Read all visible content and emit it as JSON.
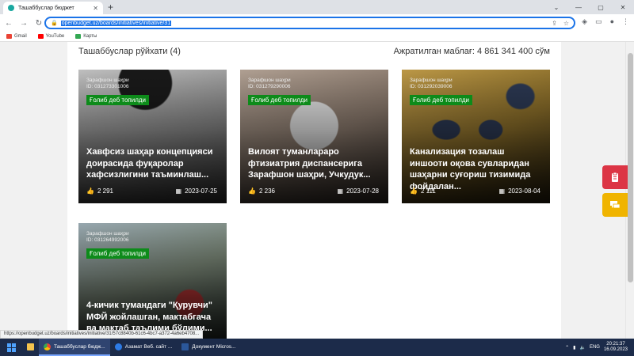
{
  "browser": {
    "tab_title": "Ташаббуслар бюджет",
    "url": "openbudget.uz/boards/initiatives/initiative/31",
    "bookmarks": [
      "Gmail",
      "YouTube",
      "Карты"
    ],
    "status_url": "https://openbudget.uz/boards/initiatives/initiative/31/57c8840b-61c6-4bc7-a372-4a6eb4708..."
  },
  "header": {
    "list_title": "Ташаббуслар рўйхати (4)",
    "allocated": "Ажратилган маблағ: 4 861 341 400 сўм"
  },
  "cards": [
    {
      "location": "Зарафшон шаҳри",
      "id": "ID: 031273301006",
      "badge": "Ғолиб деб топилди",
      "title": "Хавфсиз шаҳар концепцияси доирасида фуқаролар хафсизлигини таъминлаш...",
      "votes": "2 291",
      "date": "2023-07-25"
    },
    {
      "location": "Зарафшон шаҳри",
      "id": "ID: 031279290006",
      "badge": "Ғолиб деб топилди",
      "title": "Вилоят туманлараро фтизиатрия диспансерига Зарафшон шаҳри, Учкудук...",
      "votes": "2 236",
      "date": "2023-07-28"
    },
    {
      "location": "Зарафшон шаҳри",
      "id": "ID: 031292039006",
      "badge": "Ғолиб деб топилди",
      "title": "Канализация тозалаш иншооти оқова сувларидан шаҳарни суғориш тизимида фойдалан...",
      "votes": "2 111",
      "date": "2023-08-04"
    },
    {
      "location": "Зарафшон шаҳри",
      "id": "ID: 031264992006",
      "badge": "Ғолиб деб топилди",
      "title": "4-кичик тумандаги \"Қурувчи\" МФЙ жойлашган, мактабгача ва мактаб таълими бўлими...",
      "votes": "",
      "date": ""
    }
  ],
  "taskbar": {
    "items": [
      "Ташаббуслар бюдж...",
      "Азамат Веб. сайт ...",
      "Документ Micros..."
    ],
    "lang": "ENG",
    "time": "20:21:37",
    "date": "16.09.2023"
  },
  "colors": {
    "badge_green": "#0d8b1a",
    "float_red": "#dc3545",
    "float_yellow": "#f0b400",
    "accent_blue": "#1a73e8"
  }
}
